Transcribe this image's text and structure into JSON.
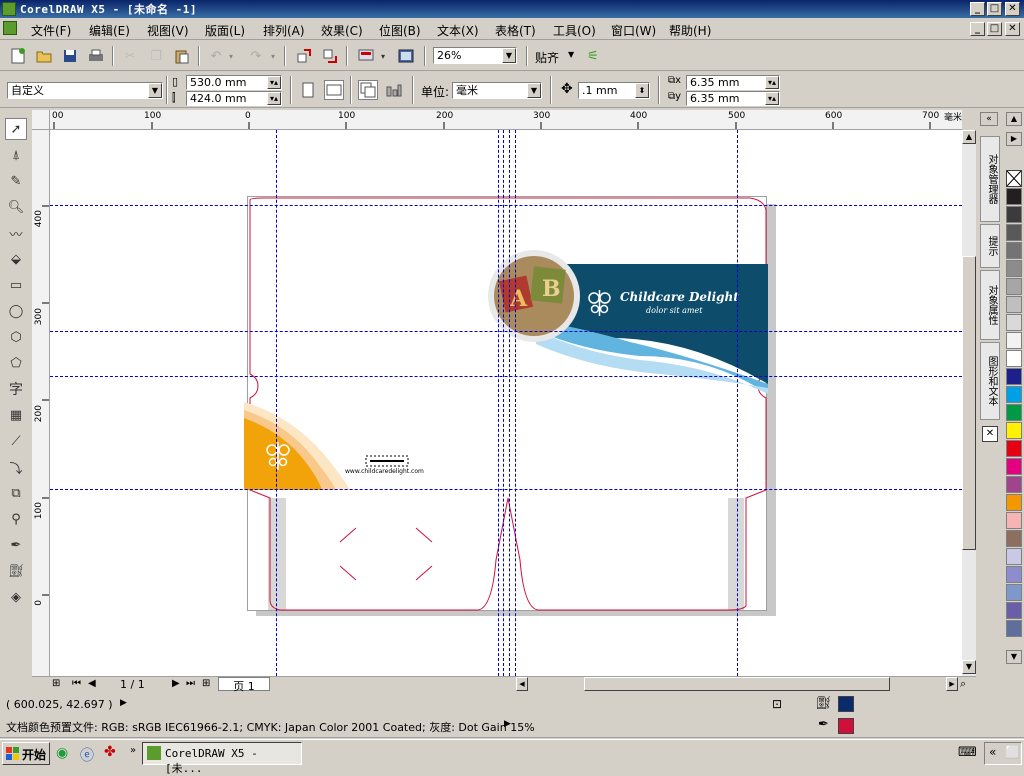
{
  "window": {
    "title": "CorelDRAW X5 - [未命名 -1]",
    "minimize": "_",
    "maximize": "□",
    "close": "✕"
  },
  "menu": {
    "items": [
      "文件(F)",
      "编辑(E)",
      "视图(V)",
      "版面(L)",
      "排列(A)",
      "效果(C)",
      "位图(B)",
      "文本(X)",
      "表格(T)",
      "工具(O)",
      "窗口(W)",
      "帮助(H)"
    ]
  },
  "toolbar": {
    "zoom": "26%",
    "snap_label": "贴齐"
  },
  "property_bar": {
    "page_size": "自定义",
    "width": "530.0 mm",
    "height": "424.0 mm",
    "units_label": "单位:",
    "units_value": "毫米",
    "nudge": ".1 mm",
    "dup_x": "6.35 mm",
    "dup_y": "6.35 mm"
  },
  "ruler": {
    "h_labels": [
      "00",
      "100",
      "0",
      "100",
      "200",
      "300",
      "400",
      "500",
      "600",
      "700"
    ],
    "h_unit": "毫米",
    "v_labels": [
      "400",
      "300",
      "200",
      "100",
      "0"
    ]
  },
  "design": {
    "brand_name": "Childcare Delight",
    "brand_tagline": "dolor sit amet",
    "website": "www.childcaredelight.com"
  },
  "dockers": {
    "tabs": [
      "对象管理器",
      "提示",
      "对象属性",
      "图形和文本"
    ]
  },
  "page_nav": {
    "counter": "1 / 1",
    "page_tab": "页 1"
  },
  "status": {
    "coords": "( 600.025, 42.697 )",
    "color_profile": "文档颜色预置文件: RGB: sRGB IEC61966-2.1; CMYK: Japan Color 2001 Coated; 灰度: Dot Gain 15%",
    "fill_color": "#0b2a6b",
    "outline_color": "#d0103a"
  },
  "taskbar": {
    "start": "开始",
    "task": "CorelDRAW X5 - [未..."
  },
  "colors": {
    "palette": [
      "#231f20",
      "#3b3b3b",
      "#595959",
      "#737373",
      "#8c8c8c",
      "#a6a6a6",
      "#bfbfbf",
      "#d9d9d9",
      "#f2f2f2",
      "#ffffff",
      "#1d2088",
      "#00a0e9",
      "#009944",
      "#fff100",
      "#e60012",
      "#e4007f",
      "#a0448e",
      "#f39800",
      "#f8b4b4",
      "#8c6f5e",
      "#c9c9e6",
      "#8c8ccf",
      "#7e99c9",
      "#6a5ea8",
      "#5e6f9e"
    ]
  }
}
